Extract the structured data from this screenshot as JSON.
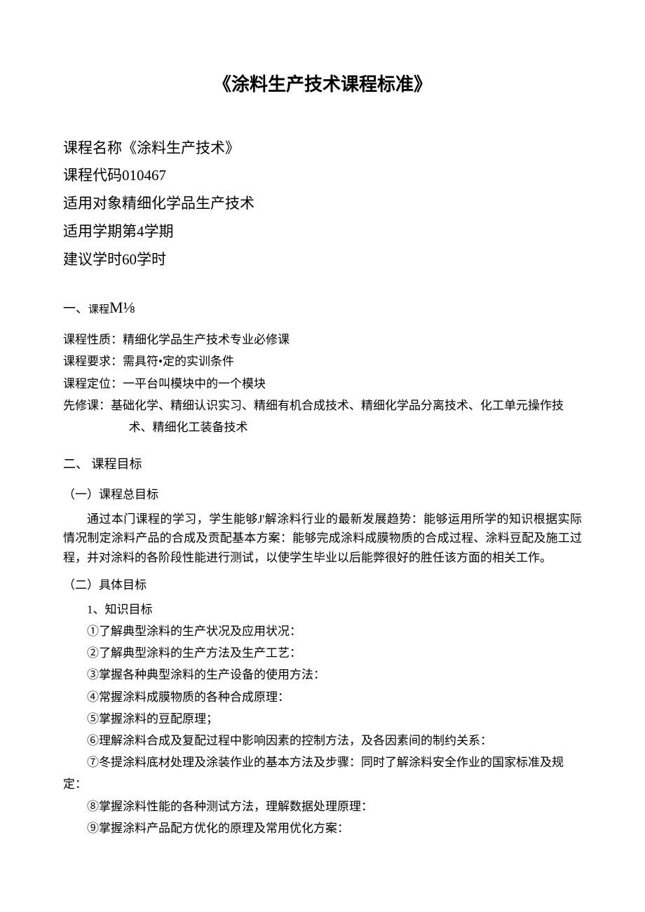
{
  "title": "《涂料生产技术课程标准》",
  "meta": {
    "name_label": "课程名称",
    "name_value": "《涂料生产技术》",
    "code_label": "课程代码",
    "code_value": "010467",
    "audience_label": "适用对象",
    "audience_value": "精细化学品生产技术",
    "semester_label": "适用学期",
    "semester_value": "第4学期",
    "hours_label": "建议学时",
    "hours_value": "60学时"
  },
  "s1": {
    "prefix": "一、",
    "label": "课程",
    "big": "M⅛",
    "nature": "课程性质：精细化学品生产技术专业必修课",
    "req": "课程要求：需具符•定的实训条件",
    "pos": "课程定位：一平台叫模块中的一个模块",
    "pre1": "先修课：基础化学、精细认识实习、精细有机合成技术、精细化学品分离技术、化工单元操作技",
    "pre2": "术、精细化工装备技术"
  },
  "s2": {
    "heading": "二、 课程目标",
    "h_overall": "（一）课程总目标",
    "overall_p": "通过本门课程的学习，学生能够J'解涂料行业的最新发展趋势：能够运用所学的知识根据实际情况制定涂料产品的合成及贡配基本方案：能够完成涂料成膜物质的合成过程、涂料豆配及施工过程，并对涂料的各阶段性能进行测试，以使学生毕业以后能弊很好的胜任该方面的相关工作。",
    "h_specific": "（二）具体目标",
    "k_heading": "1、知识目标",
    "k1": "①了解典型涂料的生产状况及应用状况：",
    "k2": "②了解典型涂料的生产方法及生产工艺：",
    "k3": "③掌握各种典型涂料的生产设备的使用方法：",
    "k4": "④常握涂料成膜物质的各种合成原理：",
    "k5": "⑤掌握涂料的豆配原理；",
    "k6": "⑥理解涂料合成及复配过程中影响因素的控制方法，及各因素间的制约关系：",
    "k7a": "⑦冬提涂料底材处理及涂装作业的基本方法及步骤：同时了解涂料安全作业的国家标准及规",
    "k7b": "定：",
    "k8": "⑧掌握涂料性能的各种测试方法，理解数据处理原理：",
    "k9": "⑨掌握涂料产品配方优化的原理及常用优化方案："
  }
}
